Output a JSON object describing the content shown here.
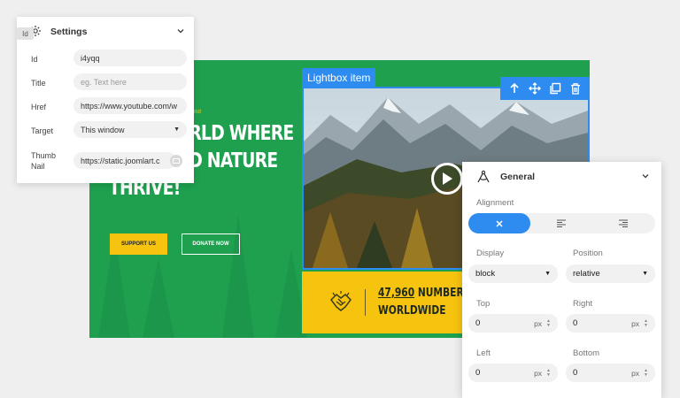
{
  "hero": {
    "tagline": "rld!",
    "headline_lines": [
      "RLD WHERE",
      "D NATURE",
      "THRIVE!"
    ],
    "support_label": "SUPPORT US",
    "donate_label": "DONATE NOW"
  },
  "lightbox": {
    "tag_label": "Lightbox item",
    "toolbar_icons": [
      "arrow-up-icon",
      "move-icon",
      "duplicate-icon",
      "trash-icon"
    ]
  },
  "stat": {
    "number": "47,960",
    "line1_rest": "NUMBER OF S",
    "line2": "WORLDWIDE"
  },
  "settings": {
    "title": "Settings",
    "id_badge": "Id",
    "fields": {
      "id": {
        "label": "Id",
        "value": "i4yqq"
      },
      "title": {
        "label": "Title",
        "placeholder": "eg. Text here"
      },
      "href": {
        "label": "Href",
        "value": "https://www.youtube.com/w"
      },
      "target": {
        "label": "Target",
        "value": "This window"
      },
      "thumb": {
        "label_1": "Thumb",
        "label_2": "Nail",
        "value": "https://static.joomlart.c"
      }
    }
  },
  "general": {
    "title": "General",
    "alignment_label": "Alignment",
    "display": {
      "label": "Display",
      "value": "block"
    },
    "position": {
      "label": "Position",
      "value": "relative"
    },
    "top": {
      "label": "Top",
      "value": "0",
      "unit": "px"
    },
    "right": {
      "label": "Right",
      "value": "0",
      "unit": "px"
    },
    "left": {
      "label": "Left",
      "value": "0",
      "unit": "px"
    },
    "bottom": {
      "label": "Bottom",
      "value": "0",
      "unit": "px"
    }
  },
  "colors": {
    "hero_green": "#1ea04f",
    "accent_blue": "#2e8cf0",
    "brand_yellow": "#f6c40f"
  }
}
